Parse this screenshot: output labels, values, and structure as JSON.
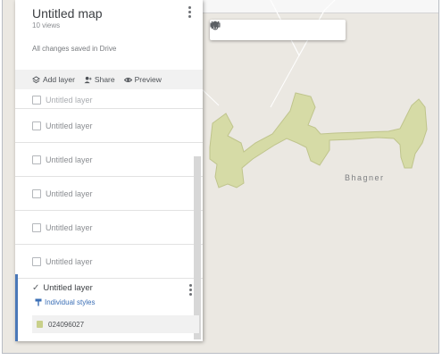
{
  "map": {
    "title": "Untitled map",
    "views": "10 views",
    "saved_status": "All changes saved in Drive",
    "place_label": "Bhagner",
    "polygon_color": "#d6dba6"
  },
  "actions": {
    "add_layer": "Add layer",
    "share": "Share",
    "preview": "Preview"
  },
  "layers": [
    {
      "label": "Untitled layer"
    },
    {
      "label": "Untitled layer"
    },
    {
      "label": "Untitled layer"
    },
    {
      "label": "Untitled layer"
    },
    {
      "label": "Untitled layer"
    },
    {
      "label": "Untitled layer"
    },
    {
      "label": "Untitled layer"
    }
  ],
  "active_layer": {
    "label": "Untitled layer",
    "styles_label": "Individual styles",
    "feature_label": "024096027"
  },
  "toolbar": [
    "undo-icon",
    "redo-icon",
    "hand-icon",
    "marker-icon",
    "draw-line-icon",
    "route-icon",
    "ruler-icon"
  ]
}
